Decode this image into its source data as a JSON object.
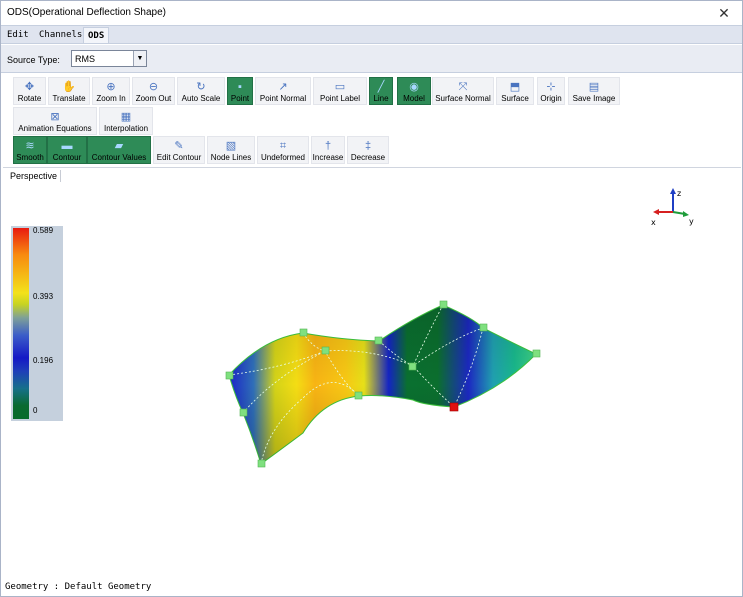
{
  "window": {
    "title": "ODS(Operational Deflection Shape)",
    "close_glyph": "✕"
  },
  "menubar": {
    "items": [
      {
        "label": "Edit"
      },
      {
        "label": "Channels"
      },
      {
        "label": "ODS"
      }
    ],
    "active_index": 2
  },
  "source": {
    "label": "Source Type:",
    "value": "RMS"
  },
  "toolbar": {
    "row1": [
      {
        "label": "Rotate",
        "icon": "rotate-arrows-icon",
        "active": false
      },
      {
        "label": "Translate",
        "icon": "hand-icon",
        "active": false
      },
      {
        "label": "Zoom In",
        "icon": "zoom-in-icon",
        "active": false
      },
      {
        "label": "Zoom Out",
        "icon": "zoom-out-icon",
        "active": false
      },
      {
        "label": "Auto Scale",
        "icon": "refresh-icon",
        "active": false
      },
      {
        "label": "Point",
        "icon": "point-icon",
        "active": true
      },
      {
        "label": "Point Normal",
        "icon": "point-normal-icon",
        "active": false
      },
      {
        "label": "Point Label",
        "icon": "point-label-icon",
        "active": false
      },
      {
        "label": "Line",
        "icon": "line-icon",
        "active": true
      },
      {
        "label": "Model",
        "icon": "model-icon",
        "active": true
      },
      {
        "label": "Surface Normal",
        "icon": "surface-normal-icon",
        "active": false
      },
      {
        "label": "Surface",
        "icon": "surface-icon",
        "active": false
      },
      {
        "label": "Origin",
        "icon": "origin-icon",
        "active": false
      },
      {
        "label": "Save Image",
        "icon": "save-image-icon",
        "active": false
      }
    ],
    "row2": [
      {
        "label": "Animation Equations",
        "icon": "animation-equations-icon",
        "active": false
      },
      {
        "label": "Interpolation",
        "icon": "interpolation-icon",
        "active": false
      }
    ],
    "row3": [
      {
        "label": "Smooth",
        "icon": "smooth-icon",
        "active": true
      },
      {
        "label": "Contour",
        "icon": "contour-icon",
        "active": true
      },
      {
        "label": "Contour Values",
        "icon": "contour-values-icon",
        "active": true
      },
      {
        "label": "Edit Contour",
        "icon": "edit-contour-icon",
        "active": false
      },
      {
        "label": "Node Lines",
        "icon": "node-lines-icon",
        "active": false
      },
      {
        "label": "Undeformed",
        "icon": "undeformed-icon",
        "active": false
      },
      {
        "label": "Increase",
        "icon": "increase-icon",
        "active": false
      },
      {
        "label": "Decrease",
        "icon": "decrease-icon",
        "active": false
      }
    ]
  },
  "view": {
    "tab_label": "Perspective"
  },
  "legend": {
    "ticks": [
      "0.589",
      "0.393",
      "0.196",
      "0"
    ]
  },
  "axes": {
    "labels": [
      "z",
      "x",
      "y"
    ]
  },
  "status": {
    "text": "Geometry : Default Geometry"
  },
  "colors": {
    "accent_active": "#2e8b57",
    "node": "#7fe07f",
    "node_highlight": "#e01010"
  }
}
